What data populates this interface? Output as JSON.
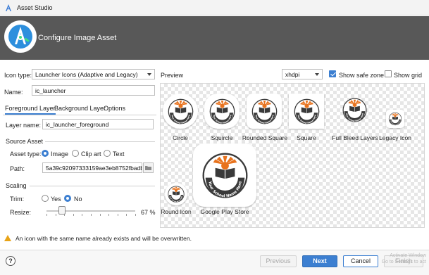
{
  "window": {
    "title": "Asset Studio"
  },
  "banner": {
    "heading": "Configure Image Asset"
  },
  "form": {
    "icon_type_label": "Icon type:",
    "icon_type_value": "Launcher Icons (Adaptive and Legacy)",
    "name_label": "Name:",
    "name_value": "ic_launcher"
  },
  "tabs": [
    "Foreground Layer",
    "Background Layer",
    "Options"
  ],
  "foreground": {
    "layer_name_label": "Layer name:",
    "layer_name_value": "ic_launcher_foreground",
    "source_asset_title": "Source Asset",
    "asset_type_label": "Asset type:",
    "asset_types": [
      "Image",
      "Clip art",
      "Text"
    ],
    "path_label": "Path:",
    "path_value": "5a39c92097333159ae3eb8752fbadb.jj",
    "scaling_title": "Scaling",
    "trim_label": "Trim:",
    "trim_options": [
      "Yes",
      "No"
    ],
    "resize_label": "Resize:",
    "resize_value": "67 %",
    "resize_percent": 67
  },
  "preview": {
    "label": "Preview",
    "density": "xhdpi",
    "show_safe_zone": "Show safe zone",
    "show_grid": "Show grid",
    "icons": [
      "Circle",
      "Squircle",
      "Rounded Square",
      "Square",
      "Full Bleed Layers",
      "Legacy Icon",
      "Round Icon",
      "Google Play Store"
    ],
    "school_text": "Your School Name Here",
    "established_text": "Established 2000"
  },
  "warning": {
    "text": "An icon with the same name already exists and will be overwritten."
  },
  "footer": {
    "help": "?",
    "previous": "Previous",
    "next": "Next",
    "cancel": "Cancel",
    "finish": "Finish",
    "watermark_line1": "Activate Window",
    "watermark_line2": "Go to Settings to act"
  },
  "colors": {
    "accent": "#3c7fd1",
    "banner": "#585858",
    "logo_dark": "#3a3a3a",
    "logo_orange": "#e8731e"
  }
}
